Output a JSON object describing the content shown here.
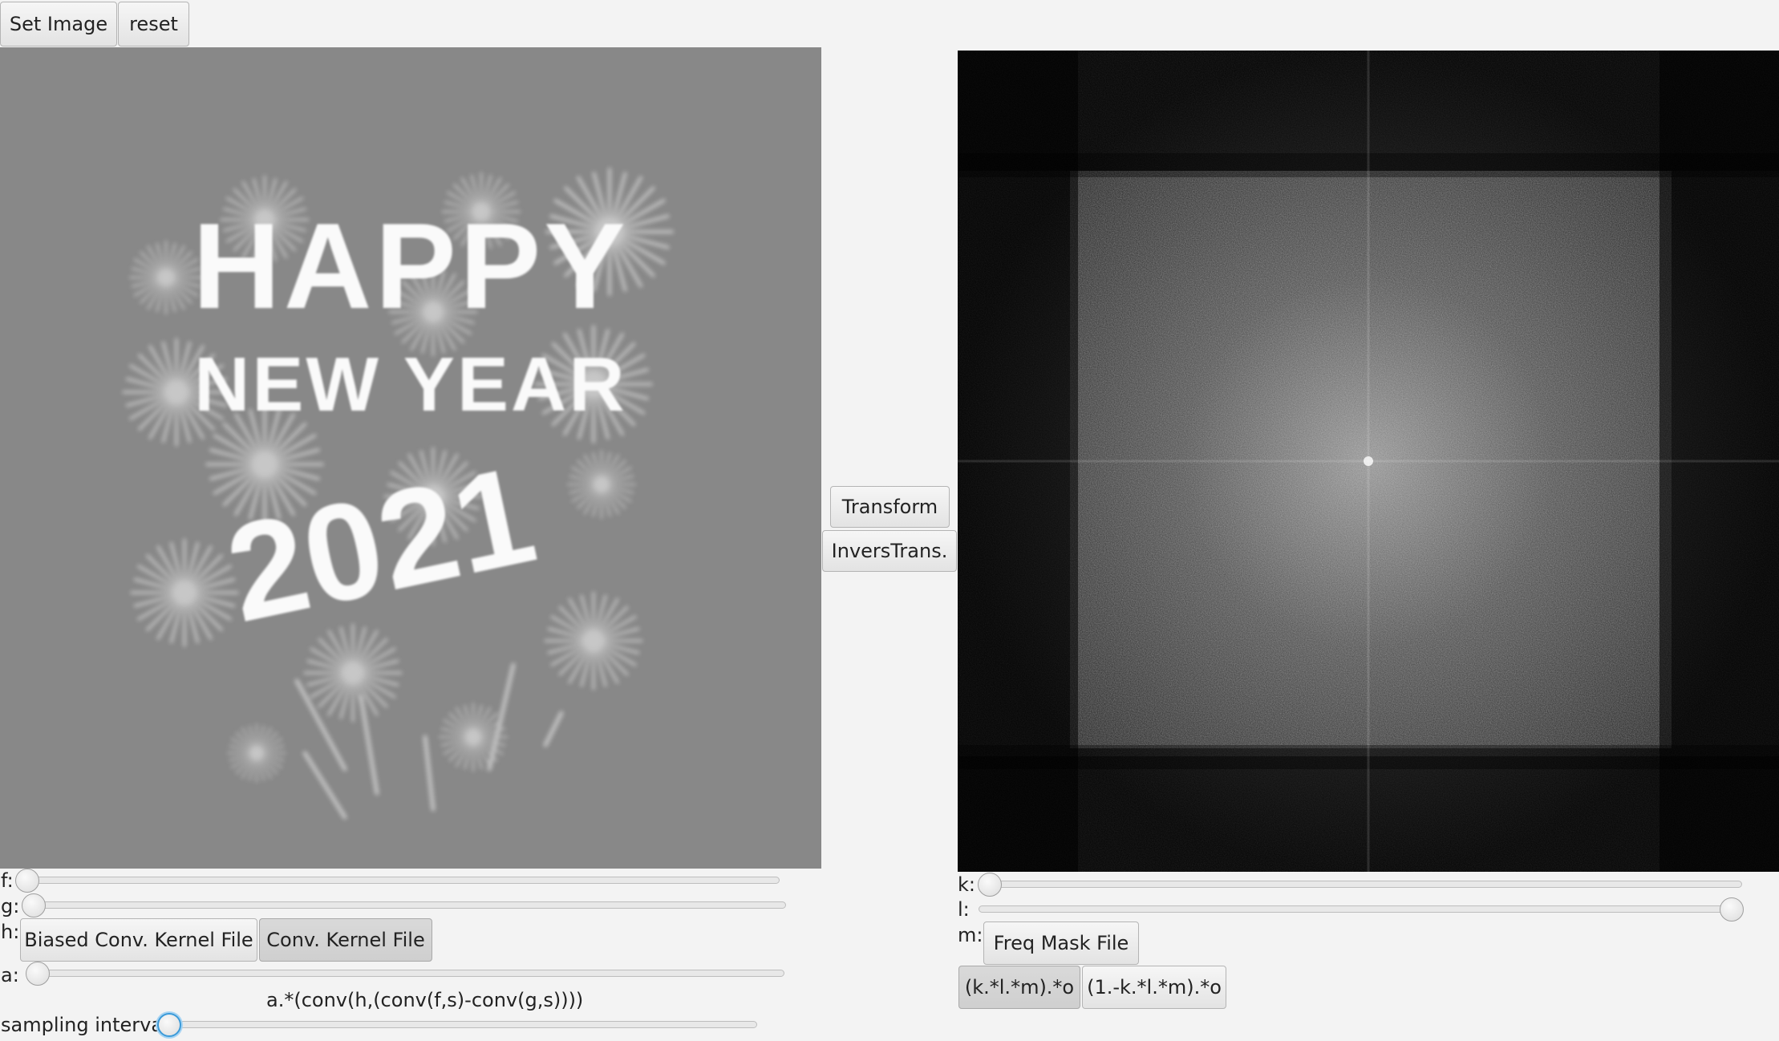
{
  "toolbar": {
    "set_image_label": "Set Image",
    "reset_label": "reset"
  },
  "source_image": {
    "line1": "HAPPY",
    "line2": "NEW YEAR",
    "line3": "2021"
  },
  "middle": {
    "transform_label": "Transform",
    "inverse_label": "InversTrans."
  },
  "left_controls": {
    "f_label": "f:",
    "f_value": 0,
    "g_label": "g:",
    "g_value": 0,
    "h_label": "h:",
    "biased_kernel_label": "Biased Conv. Kernel File",
    "conv_kernel_label": "Conv. Kernel File",
    "a_label": "a:",
    "a_value": 0,
    "formula": "a.*(conv(h,(conv(f,s)-conv(g,s))))",
    "sampling_label": "sampling interval:",
    "sampling_value": 0
  },
  "right_controls": {
    "k_label": "k:",
    "k_value": 0,
    "l_label": "l:",
    "l_value": 1,
    "m_label": "m:",
    "freq_mask_label": "Freq Mask File",
    "mode1_label": "(k.*l.*m).*o",
    "mode2_label": "(1.-k.*l.*m).*o"
  },
  "colors": {
    "source_bg": "#888888",
    "spectrum_bg": "#000000",
    "focus_ring": "#3a9ad9"
  }
}
